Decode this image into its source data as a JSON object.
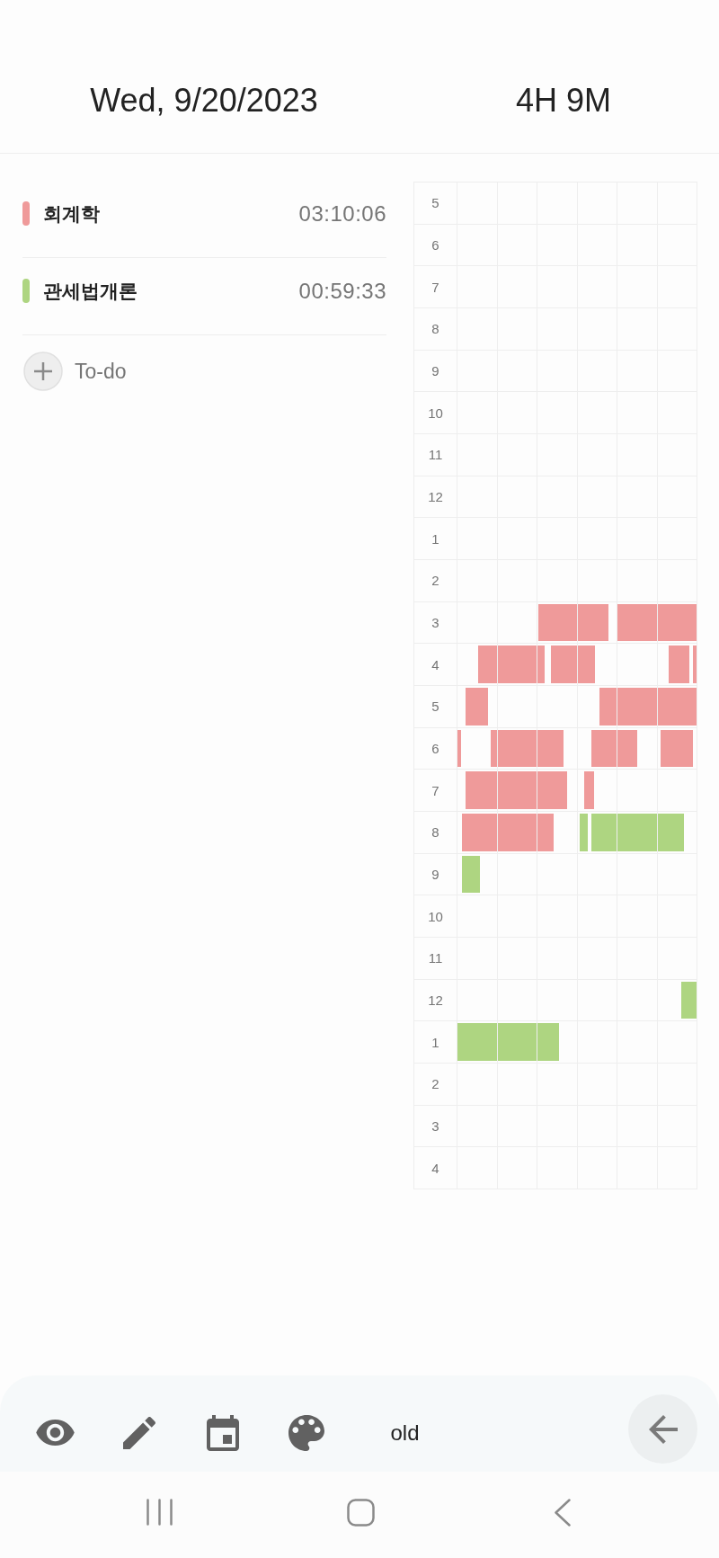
{
  "header": {
    "date": "Wed, 9/20/2023",
    "total_time": "4H 9M"
  },
  "subjects": [
    {
      "name": "회계학",
      "time": "03:10:06",
      "color": "#ef9a9a"
    },
    {
      "name": "관세법개론",
      "time": "00:59:33",
      "color": "#aed581"
    }
  ],
  "add_todo": {
    "label": "To-do"
  },
  "timetable": {
    "hours": [
      "5",
      "6",
      "7",
      "8",
      "9",
      "10",
      "11",
      "12",
      "1",
      "2",
      "3",
      "4",
      "5",
      "6",
      "7",
      "8",
      "9",
      "10",
      "11",
      "12",
      "1",
      "2",
      "3",
      "4"
    ]
  },
  "toolbar": {
    "mode_label": "old"
  }
}
